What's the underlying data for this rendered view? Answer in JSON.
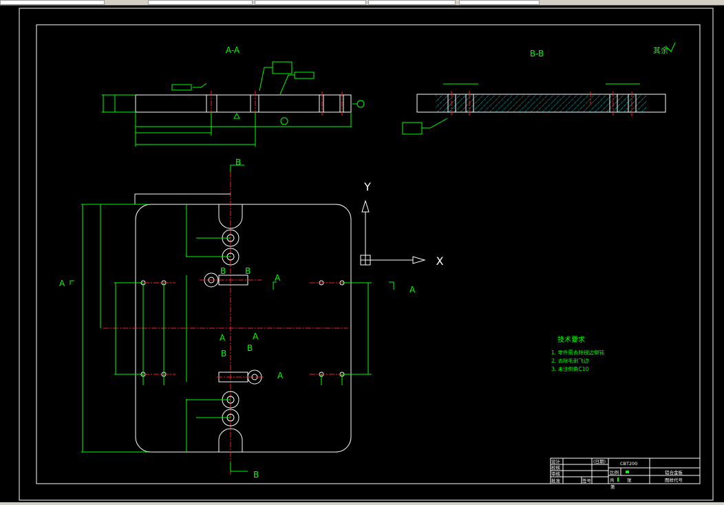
{
  "colors": {
    "background": "#000000",
    "geometry": "#ffffff",
    "dimension": "#00ff00",
    "centerline": "#ff2020",
    "hatch": "#00ffff"
  },
  "sections": {
    "aa_title": "A-A",
    "bb_title": "B-B",
    "surface_note": "其余"
  },
  "view_labels": {
    "a": "A",
    "b": "B"
  },
  "ucs": {
    "x_label": "X",
    "y_label": "Y"
  },
  "tech": {
    "title": "技术要求",
    "items": [
      "1. 零件需去除锐边倒钝",
      "2. 去除毛刺飞边",
      "3. 未注倒角C10"
    ]
  },
  "title_block": {
    "design": "设计",
    "check": "校核",
    "review": "审核",
    "approve": "批准",
    "date": "(日期)",
    "drawing_no": "CBT200",
    "scale": "比例",
    "material": "铝合金板",
    "total": "共",
    "sheets": "张",
    "sheet_no": "第",
    "code": "图样代号",
    "signature": "签号",
    "sheet_label": "张"
  }
}
